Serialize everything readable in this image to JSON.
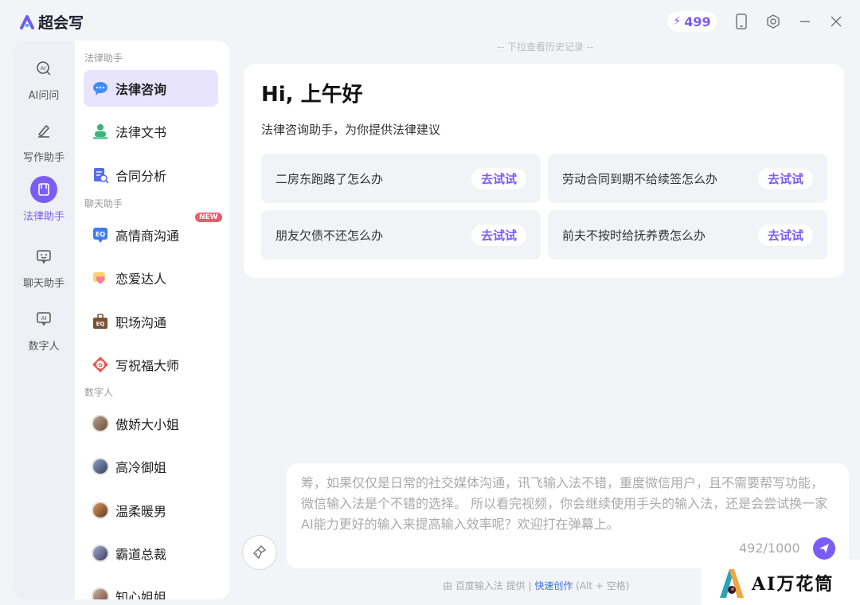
{
  "app": {
    "name": "超会写",
    "credits": "499"
  },
  "rail": {
    "items": [
      {
        "label": "AI问问"
      },
      {
        "label": "写作助手"
      },
      {
        "label": "法律助手"
      },
      {
        "label": "聊天助手"
      },
      {
        "label": "数字人"
      }
    ]
  },
  "sidelist": {
    "sections": [
      {
        "title": "法律助手",
        "items": [
          "法律咨询",
          "法律文书",
          "合同分析"
        ]
      },
      {
        "title": "聊天助手",
        "items": [
          "高情商沟通",
          "恋爱达人",
          "职场沟通",
          "写祝福大师"
        ]
      },
      {
        "title": "数字人",
        "items": [
          "傲娇大小姐",
          "高冷御姐",
          "温柔暖男",
          "霸道总裁",
          "知心姐姐"
        ]
      }
    ],
    "new_badge": "NEW"
  },
  "main": {
    "history_hint": "-- 下拉查看历史记录 --",
    "greeting": "Hi, 上午好",
    "subtitle": "法律咨询助手，为你提供法律建议",
    "try_label": "去试试",
    "suggestions": [
      "二房东跑路了怎么办",
      "劳动合同到期不给续签怎么办",
      "朋友欠债不还怎么办",
      "前夫不按时给抚养费怎么办"
    ]
  },
  "input": {
    "text": "筹，如果仅仅是日常的社交媒体沟通，讯飞输入法不错，重度微信用户，且不需要帮写功能，微信输入法是个不错的选择。 所以看完视频，你会继续使用手头的输入法，还是会尝试换一家AI能力更好的输入来提高输入效率呢？欢迎打在弹幕上。",
    "counter": "492/1000"
  },
  "footer": {
    "prefix": "由 百度输入法 提供 | ",
    "link": "快速创作",
    "suffix": " (Alt + 空格)"
  },
  "watermark": {
    "text": "AI万花筒"
  },
  "colors": {
    "accent": "#7b5cf5",
    "background": "#f3f4f8"
  }
}
